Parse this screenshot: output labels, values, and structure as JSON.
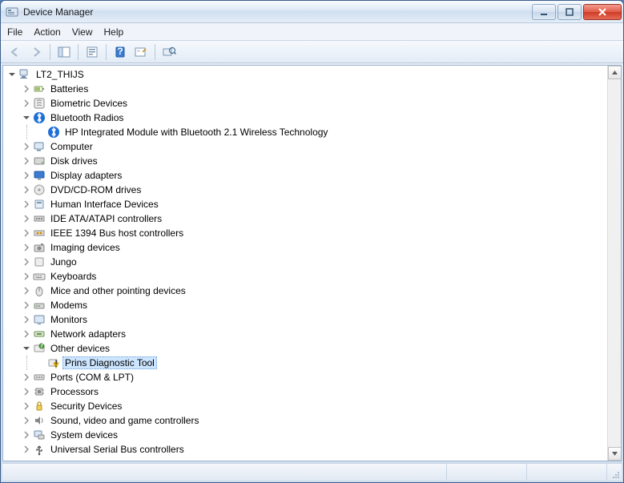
{
  "window": {
    "title": "Device Manager"
  },
  "menu": {
    "file": "File",
    "action": "Action",
    "view": "View",
    "help": "Help"
  },
  "tree": {
    "root": "LT2_THIJS",
    "nodes": [
      {
        "label": "Batteries",
        "icon": "battery",
        "expanded": false
      },
      {
        "label": "Biometric Devices",
        "icon": "fingerprint",
        "expanded": false
      },
      {
        "label": "Bluetooth Radios",
        "icon": "bluetooth",
        "expanded": true,
        "children": [
          {
            "label": "HP Integrated Module with Bluetooth 2.1 Wireless Technology",
            "icon": "bluetooth"
          }
        ]
      },
      {
        "label": "Computer",
        "icon": "computer",
        "expanded": false
      },
      {
        "label": "Disk drives",
        "icon": "disk",
        "expanded": false
      },
      {
        "label": "Display adapters",
        "icon": "display",
        "expanded": false
      },
      {
        "label": "DVD/CD-ROM drives",
        "icon": "cdrom",
        "expanded": false
      },
      {
        "label": "Human Interface Devices",
        "icon": "hid",
        "expanded": false
      },
      {
        "label": "IDE ATA/ATAPI controllers",
        "icon": "ide",
        "expanded": false
      },
      {
        "label": "IEEE 1394 Bus host controllers",
        "icon": "firewire",
        "expanded": false
      },
      {
        "label": "Imaging devices",
        "icon": "camera",
        "expanded": false
      },
      {
        "label": "Jungo",
        "icon": "generic",
        "expanded": false
      },
      {
        "label": "Keyboards",
        "icon": "keyboard",
        "expanded": false
      },
      {
        "label": "Mice and other pointing devices",
        "icon": "mouse",
        "expanded": false
      },
      {
        "label": "Modems",
        "icon": "modem",
        "expanded": false
      },
      {
        "label": "Monitors",
        "icon": "monitor",
        "expanded": false
      },
      {
        "label": "Network adapters",
        "icon": "network",
        "expanded": false
      },
      {
        "label": "Other devices",
        "icon": "other",
        "expanded": true,
        "children": [
          {
            "label": "Prins Diagnostic Tool",
            "icon": "warning",
            "selected": true
          }
        ]
      },
      {
        "label": "Ports (COM & LPT)",
        "icon": "port",
        "expanded": false
      },
      {
        "label": "Processors",
        "icon": "cpu",
        "expanded": false
      },
      {
        "label": "Security Devices",
        "icon": "security",
        "expanded": false
      },
      {
        "label": "Sound, video and game controllers",
        "icon": "sound",
        "expanded": false
      },
      {
        "label": "System devices",
        "icon": "system",
        "expanded": false
      },
      {
        "label": "Universal Serial Bus controllers",
        "icon": "usb",
        "expanded": false
      }
    ]
  }
}
